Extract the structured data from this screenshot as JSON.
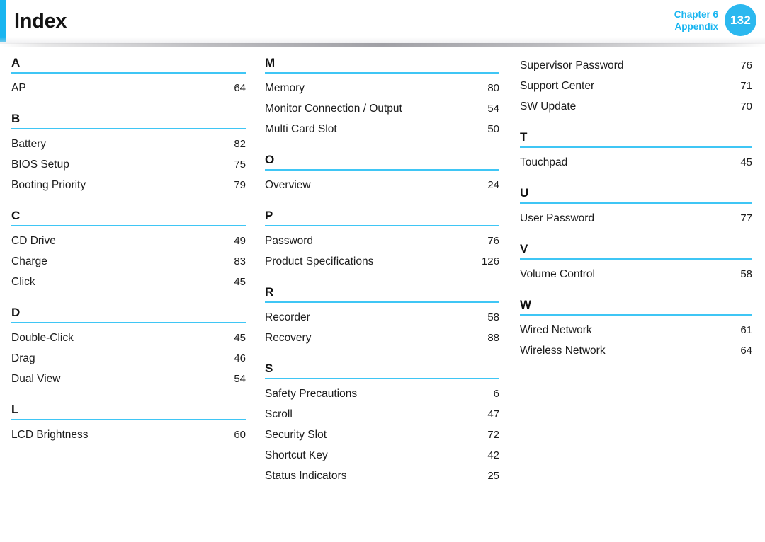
{
  "header": {
    "title": "Index",
    "chapter_line1": "Chapter 6",
    "chapter_line2": "Appendix",
    "page_number": "132",
    "accent_color": "#19b5f0",
    "badge_color": "#2bb8ef"
  },
  "columns": [
    {
      "groups": [
        {
          "letter": "A",
          "entries": [
            {
              "label": "AP",
              "page": "64"
            }
          ]
        },
        {
          "letter": "B",
          "entries": [
            {
              "label": "Battery",
              "page": "82"
            },
            {
              "label": "BIOS Setup",
              "page": "75"
            },
            {
              "label": "Booting Priority",
              "page": "79"
            }
          ]
        },
        {
          "letter": "C",
          "entries": [
            {
              "label": "CD Drive",
              "page": "49"
            },
            {
              "label": "Charge",
              "page": "83"
            },
            {
              "label": "Click",
              "page": "45"
            }
          ]
        },
        {
          "letter": "D",
          "entries": [
            {
              "label": "Double-Click",
              "page": "45"
            },
            {
              "label": "Drag",
              "page": "46"
            },
            {
              "label": "Dual View",
              "page": "54"
            }
          ]
        },
        {
          "letter": "L",
          "entries": [
            {
              "label": "LCD Brightness",
              "page": "60"
            }
          ]
        }
      ]
    },
    {
      "groups": [
        {
          "letter": "M",
          "entries": [
            {
              "label": "Memory",
              "page": "80"
            },
            {
              "label": "Monitor Connection / Output",
              "page": "54"
            },
            {
              "label": "Multi Card Slot",
              "page": "50"
            }
          ]
        },
        {
          "letter": "O",
          "entries": [
            {
              "label": "Overview",
              "page": "24"
            }
          ]
        },
        {
          "letter": "P",
          "entries": [
            {
              "label": "Password",
              "page": "76"
            },
            {
              "label": "Product Specifications",
              "page": "126"
            }
          ]
        },
        {
          "letter": "R",
          "entries": [
            {
              "label": "Recorder",
              "page": "58"
            },
            {
              "label": "Recovery",
              "page": "88"
            }
          ]
        },
        {
          "letter": "S",
          "entries": [
            {
              "label": "Safety Precautions",
              "page": "6"
            },
            {
              "label": "Scroll",
              "page": "47"
            },
            {
              "label": "Security Slot",
              "page": "72"
            },
            {
              "label": "Shortcut Key",
              "page": "42"
            },
            {
              "label": "Status Indicators",
              "page": "25"
            }
          ]
        }
      ]
    },
    {
      "groups": [
        {
          "letter": "",
          "entries": [
            {
              "label": "Supervisor Password",
              "page": "76"
            },
            {
              "label": "Support Center",
              "page": "71"
            },
            {
              "label": "SW Update",
              "page": "70"
            }
          ]
        },
        {
          "letter": "T",
          "entries": [
            {
              "label": "Touchpad",
              "page": "45"
            }
          ]
        },
        {
          "letter": "U",
          "entries": [
            {
              "label": "User Password",
              "page": "77"
            }
          ]
        },
        {
          "letter": "V",
          "entries": [
            {
              "label": "Volume Control",
              "page": "58"
            }
          ]
        },
        {
          "letter": "W",
          "entries": [
            {
              "label": "Wired Network",
              "page": "61"
            },
            {
              "label": "Wireless Network",
              "page": "64"
            }
          ]
        }
      ]
    }
  ]
}
